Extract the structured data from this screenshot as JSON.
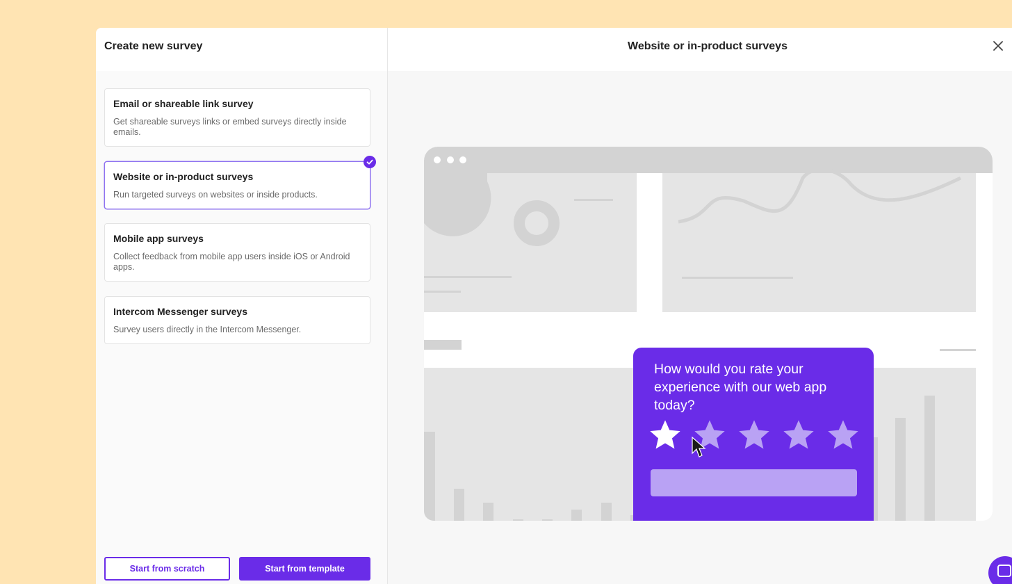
{
  "left_panel": {
    "title": "Create new survey"
  },
  "options": [
    {
      "title": "Email or shareable link survey",
      "description": "Get shareable surveys links or embed surveys directly inside emails."
    },
    {
      "title": "Website or in-product surveys",
      "description": "Run targeted surveys on websites or inside products."
    },
    {
      "title": "Mobile app surveys",
      "description": "Collect feedback from mobile app users inside iOS or Android apps."
    },
    {
      "title": "Intercom Messenger surveys",
      "description": "Survey users directly in the Intercom Messenger."
    }
  ],
  "selected_option": "Website or in-product surveys",
  "buttons": {
    "scratch": "Start from scratch",
    "template": "Start from template"
  },
  "right_panel": {
    "title": "Website or in-product surveys"
  },
  "preview": {
    "question": "How would you rate your experience with our web app today?",
    "rating_selected": 1,
    "rating_max": 5
  },
  "colors": {
    "accent": "#6a2ce8",
    "background": "#ffe4b3",
    "star_inactive": "#b9a2f4"
  },
  "icons": {
    "close": "close-icon",
    "check": "check-circle-icon",
    "star": "star-icon",
    "cursor": "mouse-cursor-icon",
    "launcher": "messenger-launcher-icon"
  }
}
